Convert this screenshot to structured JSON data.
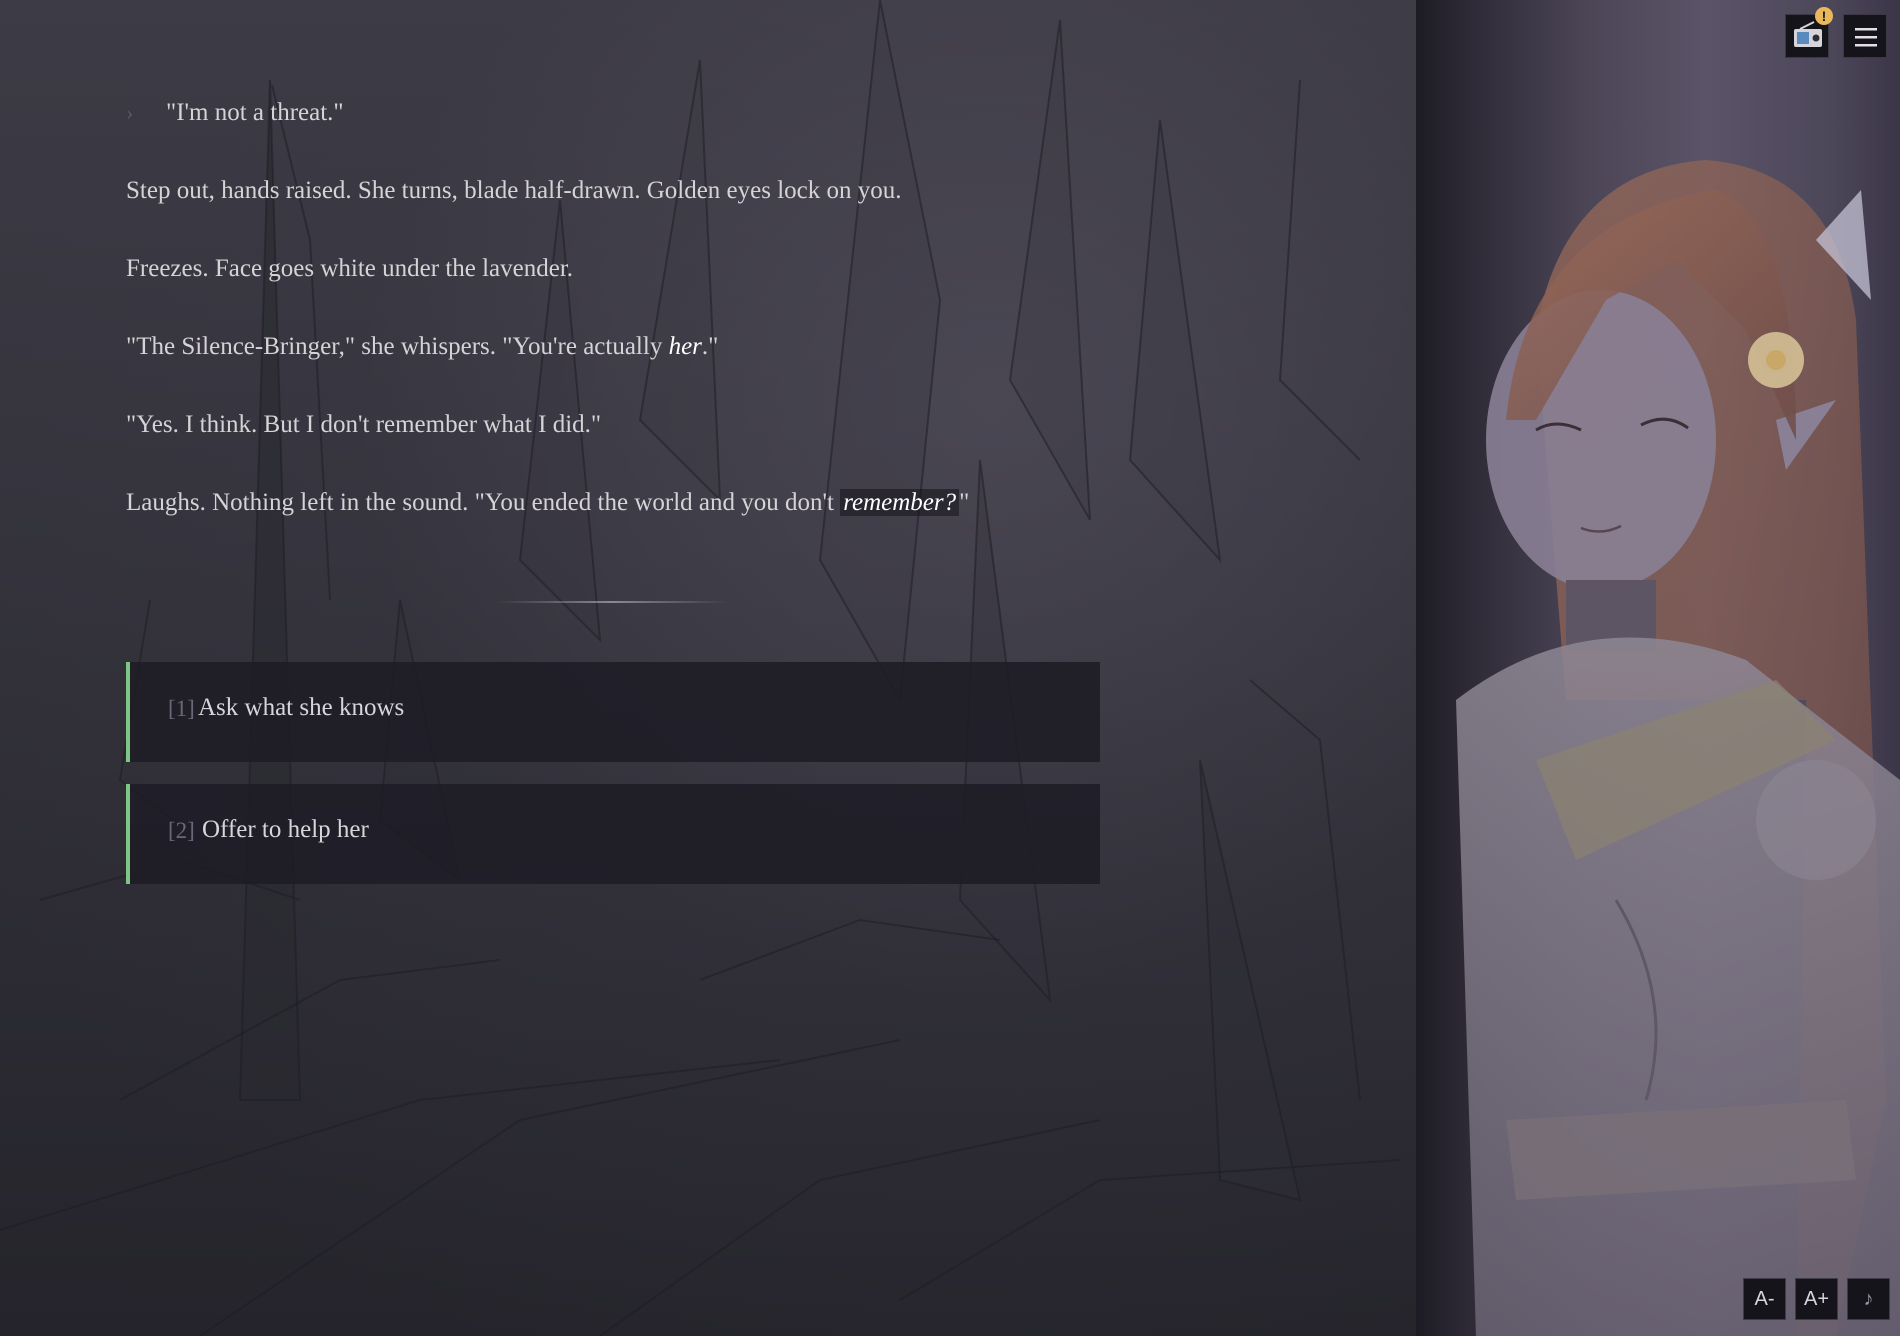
{
  "story": {
    "choice_echo": "\"I'm not a threat.\"",
    "p1": "Step out, hands raised. She turns, blade half-drawn. Golden eyes lock on you.",
    "p2": "Freezes. Face goes white under the lavender.",
    "p3_a": "\"The Silence-Bringer,\" she whispers. \"You're actually ",
    "p3_em": "her",
    "p3_b": ".\"",
    "p4": "\"Yes. I think. But I don't remember what I did.\"",
    "p5_a": "Laughs. Nothing left in the sound. \"You ended the world and you don't ",
    "p5_em": "remember?",
    "p5_b": "\""
  },
  "choices": [
    {
      "num": "[1]",
      "label": "Ask what she knows"
    },
    {
      "num": "[2]",
      "label": "Offer to help her"
    }
  ],
  "toolbar": {
    "radio_icon": "radio-icon",
    "menu_icon": "hamburger-menu-icon",
    "badge": "!",
    "font_decrease": "A-",
    "font_increase": "A+",
    "music": "♪"
  },
  "colors": {
    "choice_accent": "#7dc686",
    "badge": "#e9b85a"
  }
}
